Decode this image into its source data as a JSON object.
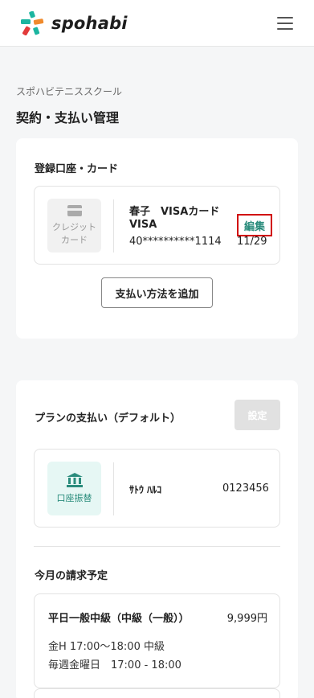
{
  "header": {
    "logo_text": "spohabi",
    "menu_icon": "hamburger-menu-icon",
    "brand_colors": {
      "teal": "#1bb5a0",
      "orange": "#f08a2c",
      "red": "#e23b3b"
    }
  },
  "breadcrumb": "スポハビテニススクール",
  "page_title": "契約・支払い管理",
  "registered": {
    "section_title": "登録口座・カード",
    "card": {
      "type_label": "クレジット\nカード",
      "type_icon": "credit-card-icon",
      "holder": "春子　VISAカード",
      "brand": "VISA",
      "number": "40**********1114",
      "expiry": "11/29",
      "edit_label": "編集"
    },
    "add_button_label": "支払い方法を追加"
  },
  "plan_payment": {
    "section_title": "プランの支払い（デフォルト）",
    "set_button_label": "設定",
    "method": {
      "type_label": "口座振替",
      "type_icon": "bank-icon",
      "account_name": "ｻﾄｳ ﾊﾙｺ",
      "account_number": "0123456"
    }
  },
  "billing": {
    "section_title": "今月の請求予定",
    "items": [
      {
        "plan": "平日一般中級（中級（一般））",
        "price": "9,999円",
        "detail1": "金H 17:00〜18:00 中級",
        "detail2": "毎週金曜日　17:00 - 18:00"
      }
    ]
  },
  "colors": {
    "accent": "#2a8c7c",
    "highlight_border": "#d10000",
    "disabled": "#e1e1e1"
  }
}
